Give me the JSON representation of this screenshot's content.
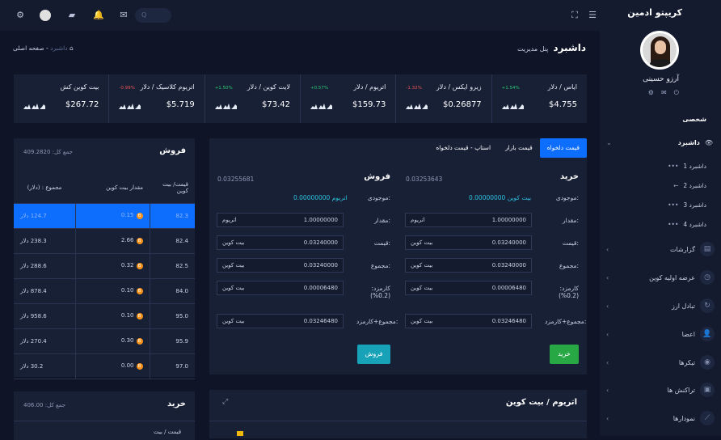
{
  "sidebar": {
    "brand": "کریپتو ادمین",
    "user_name": "آرزو حسینی",
    "section": "شخصی",
    "dashboard_label": "داشبرد",
    "sub_items": [
      "داشبرد 1",
      "داشبرد 2",
      "داشبرد 3",
      "داشبرد 4"
    ],
    "items": [
      "گزارشات",
      "عرضه اولیه کوین",
      "تبادل ارز",
      "اعضا",
      "تیکرها",
      "تراکنش ها",
      "نمودارها"
    ]
  },
  "page": {
    "title": "داشبرد",
    "subtitle": "پنل مدیریت",
    "breadcrumb_home": "صفحه اصلی",
    "breadcrumb_sep": "-",
    "breadcrumb_current": "داشبرد"
  },
  "search": {
    "placeholder": "Q"
  },
  "tickers": [
    {
      "name": "ایاس / دلار",
      "change": "+1.54%",
      "price": "$4.755",
      "up": true
    },
    {
      "name": "زیرو ایکس / دلار",
      "change": "-1.32%",
      "price": "$0.26877",
      "up": false
    },
    {
      "name": "اتریوم / دلار",
      "change": "+0.57%",
      "price": "$159.73",
      "up": true
    },
    {
      "name": "لایت کوین / دلار",
      "change": "+1.50%",
      "price": "$73.42",
      "up": true
    },
    {
      "name": "اتریوم کلاسیک / دلار",
      "change": "-0.99%",
      "price": "$5.719",
      "up": false
    },
    {
      "name": "بیت کوین کش",
      "change": "",
      "price": "$267.72",
      "up": true
    }
  ],
  "trade": {
    "tabs": [
      "قیمت دلخواه",
      "قیمت بازار",
      "استاپ - قیمت دلخواه"
    ],
    "buy": {
      "title": "خرید",
      "price_top": "0.03253643",
      "balance_label": "موجودی:",
      "balance_value": "0.00000000 بیت کوین",
      "rows": [
        {
          "label": "مقدار:",
          "value": "1.00000000",
          "unit": "اتریوم"
        },
        {
          "label": "قیمت:",
          "value": "0.03240000",
          "unit": "بیت کوین"
        },
        {
          "label": "مجموع:",
          "value": "0.03240000",
          "unit": "بیت کوین"
        },
        {
          "label": "کارمزد: (0.2%)",
          "value": "0.00006480",
          "unit": "بیت کوین"
        },
        {
          "label": "مجموع+کارمزد:",
          "value": "0.03246480",
          "unit": "بیت کوین"
        }
      ],
      "button": "خرید"
    },
    "sell": {
      "title": "فروش",
      "price_top": "0.03255681",
      "balance_label": "موجودی:",
      "balance_value": "0.00000000 اتریوم",
      "rows": [
        {
          "label": "مقدار:",
          "value": "1.00000000",
          "unit": "اتریوم"
        },
        {
          "label": "قیمت:",
          "value": "0.03240000",
          "unit": "بیت کوین"
        },
        {
          "label": "مجموع:",
          "value": "0.03240000",
          "unit": "بیت کوین"
        },
        {
          "label": "کارمزد: (0.2%)",
          "value": "0.00006480",
          "unit": "بیت کوین"
        },
        {
          "label": "مجموع+کارمزد:",
          "value": "0.03246480",
          "unit": "بیت کوین"
        }
      ],
      "button": "فروش"
    }
  },
  "sell_orders": {
    "title": "فروش",
    "total": "جمع کل: 409.2820",
    "headers": [
      "قیمت/ بیت کوین",
      "مقدار بیت کوین",
      "مجموع : (دلار)"
    ],
    "rows": [
      [
        "82.3",
        "0.15",
        "124.7 دلار"
      ],
      [
        "82.4",
        "2.66",
        "238.3 دلار"
      ],
      [
        "82.5",
        "0.32",
        "288.6 دلار"
      ],
      [
        "84.0",
        "0.10",
        "878.4 دلار"
      ],
      [
        "95.0",
        "0.10",
        "958.6 دلار"
      ],
      [
        "95.9",
        "0.30",
        "270.4 دلار"
      ],
      [
        "97.0",
        "0.00",
        "30.2 دلار"
      ]
    ]
  },
  "buy_orders": {
    "title": "خرید",
    "total": "جمع کل: 406.00",
    "header_partial": "قیمت / بیت"
  },
  "chart_card": {
    "title": "اتریوم / بیت کوین"
  },
  "colors": {
    "accent": "#0d6efd",
    "buy": "#28a745",
    "sell": "#17a2b8",
    "up": "#28c76f",
    "down": "#ea5455"
  }
}
